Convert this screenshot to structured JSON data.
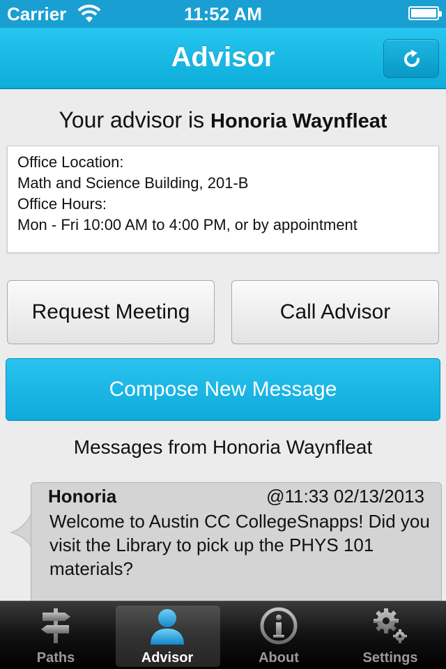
{
  "status_bar": {
    "carrier": "Carrier",
    "time": "11:52 AM"
  },
  "nav": {
    "title": "Advisor",
    "refresh_icon": "refresh-icon"
  },
  "advisor": {
    "prefix": "Your advisor is",
    "name": "Honoria Waynfleat"
  },
  "office": {
    "location_label": "Office Location:",
    "location": "Math and Science Building, 201-B",
    "hours_label": "Office Hours:",
    "hours": "Mon - Fri 10:00 AM to 4:00 PM, or by appointment"
  },
  "actions": {
    "request_meeting": "Request Meeting",
    "call_advisor": "Call Advisor",
    "compose": "Compose New Message"
  },
  "messages": {
    "heading": "Messages from Honoria Waynfleat",
    "items": [
      {
        "sender": "Honoria",
        "timestamp": "@11:33 02/13/2013",
        "body": "Welcome to Austin CC CollegeSnapps! Did you visit the Library to pick up the PHYS 101 materials?"
      }
    ]
  },
  "tabs": [
    {
      "label": "Paths",
      "icon": "signpost-icon"
    },
    {
      "label": "Advisor",
      "icon": "person-icon",
      "selected": true
    },
    {
      "label": "About",
      "icon": "info-icon"
    },
    {
      "label": "Settings",
      "icon": "gear-icon"
    }
  ],
  "colors": {
    "accent": "#1ab4e1",
    "tab_bar": "#111111",
    "bubble": "#d4d4d4"
  }
}
